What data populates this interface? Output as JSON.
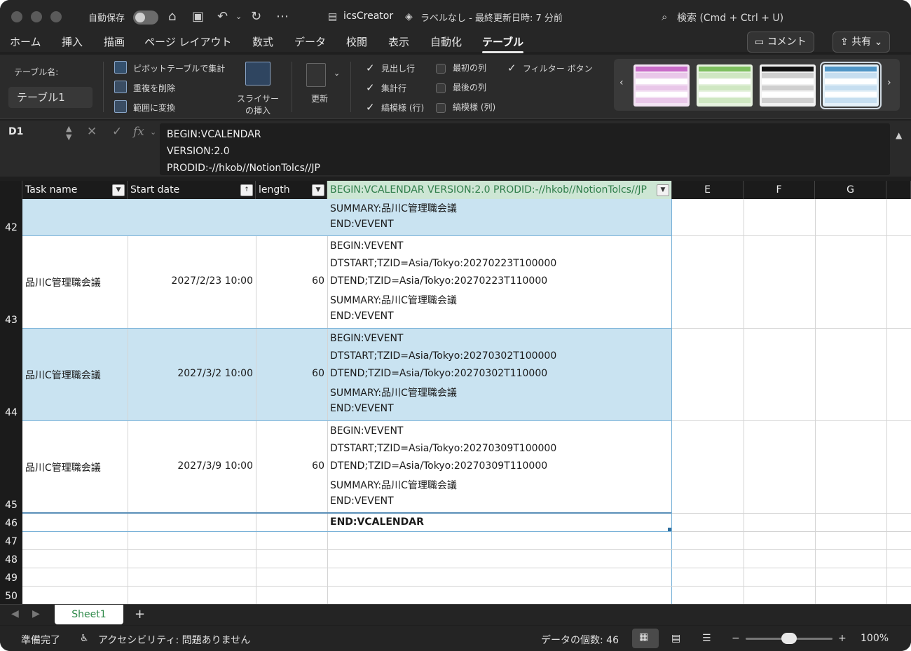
{
  "titlebar": {
    "autosave_label": "自動保存",
    "document_name": "icsCreator",
    "sensitivity_status": "ラベルなし - 最終更新日時: 7 分前",
    "search_placeholder": "検索 (Cmd + Ctrl + U)"
  },
  "ribbon_tabs": [
    "ホーム",
    "挿入",
    "描画",
    "ページ レイアウト",
    "数式",
    "データ",
    "校閲",
    "表示",
    "自動化",
    "テーブル"
  ],
  "header_buttons": {
    "comment": "コメント",
    "share": "共有"
  },
  "ribbon": {
    "table_name_label": "テーブル名:",
    "table_name_value": "テーブル1",
    "pivot": "ピボットテーブルで集計",
    "remove_duplicates": "重複を削除",
    "convert_to_range": "範囲に変換",
    "slicer_line1": "スライサー",
    "slicer_line2": "の挿入",
    "refresh": "更新",
    "options": {
      "header_row": "見出し行",
      "total_row": "集計行",
      "banded_rows": "縞模様 (行)",
      "first_column": "最初の列",
      "last_column": "最後の列",
      "banded_columns": "縞模様 (列)",
      "filter_button": "フィルター ボタン"
    }
  },
  "formula_bar": {
    "name_box": "D1",
    "fx": "fx",
    "lines": [
      "BEGIN:VCALENDAR",
      "VERSION:2.0",
      "PRODID:-//hkob//NotionTolcs//JP"
    ]
  },
  "columns": {
    "a": "Task name",
    "b": "Start date",
    "c": "length",
    "d": "BEGIN:VCALENDAR VERSION:2.0 PRODID:-//hkob//NotionTolcs//JP",
    "e": "E",
    "f": "F",
    "g": "G"
  },
  "rows": {
    "r42": {
      "num": "42",
      "d": [
        "SUMMARY:品川C管理職会議",
        "END:VEVENT"
      ]
    },
    "r43": {
      "num": "43",
      "task": "品川C管理職会議",
      "start": "2027/2/23 10:00",
      "length": "60",
      "d": [
        "BEGIN:VEVENT",
        "DTSTART;TZID=Asia/Tokyo:20270223T100000",
        "DTEND;TZID=Asia/Tokyo:20270223T110000",
        "SUMMARY:品川C管理職会議",
        "END:VEVENT"
      ]
    },
    "r44": {
      "num": "44",
      "task": "品川C管理職会議",
      "start": "2027/3/2 10:00",
      "length": "60",
      "d": [
        "BEGIN:VEVENT",
        "DTSTART;TZID=Asia/Tokyo:20270302T100000",
        "DTEND;TZID=Asia/Tokyo:20270302T110000",
        "SUMMARY:品川C管理職会議",
        "END:VEVENT"
      ]
    },
    "r45": {
      "num": "45",
      "task": "品川C管理職会議",
      "start": "2027/3/9 10:00",
      "length": "60",
      "d": [
        "BEGIN:VEVENT",
        "DTSTART;TZID=Asia/Tokyo:20270309T100000",
        "DTEND;TZID=Asia/Tokyo:20270309T110000",
        "SUMMARY:品川C管理職会議",
        "END:VEVENT"
      ]
    },
    "r46": {
      "num": "46",
      "d": "END:VCALENDAR"
    },
    "empty_rows": [
      "47",
      "48",
      "49",
      "50"
    ]
  },
  "sheets": {
    "active": "Sheet1",
    "add": "+"
  },
  "status": {
    "ready": "準備完了",
    "accessibility": "アクセシビリティ: 問題ありません",
    "count": "データの個数: 46",
    "zoom": "100%",
    "zoom_minus": "−",
    "zoom_plus": "+",
    "zoom_level": 0.5
  },
  "colors": {
    "table_band": "#c9e3f1",
    "header_green": "#cde6d4",
    "dark_chrome": "#1f1f1f"
  }
}
